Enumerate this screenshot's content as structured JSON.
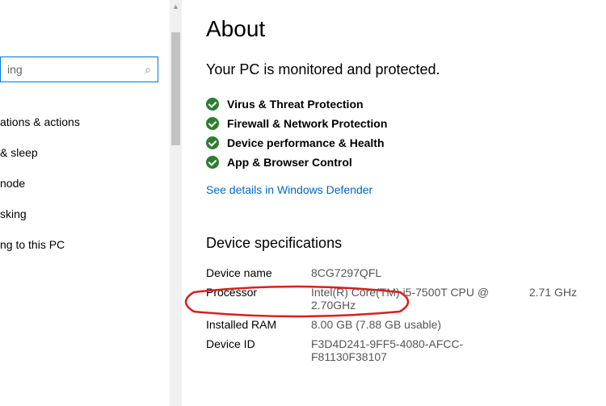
{
  "header": {
    "title": "About",
    "subtitle": "Your PC is monitored and protected."
  },
  "search": {
    "placeholder": "ing"
  },
  "sidebar": {
    "items": [
      {
        "label": "ations & actions"
      },
      {
        "label": "& sleep"
      },
      {
        "label": "node"
      },
      {
        "label": "sking"
      },
      {
        "label": "ng to this PC"
      }
    ]
  },
  "protection": {
    "items": [
      {
        "label": "Virus & Threat Protection"
      },
      {
        "label": "Firewall & Network Protection"
      },
      {
        "label": "Device performance & Health"
      },
      {
        "label": "App & Browser Control"
      }
    ],
    "link": "See details in Windows Defender"
  },
  "specs": {
    "heading": "Device specifications",
    "rows": [
      {
        "label": "Device name",
        "value": "8CG7297QFL",
        "extra": ""
      },
      {
        "label": "Processor",
        "value": "Intel(R) Core(TM) i5-7500T CPU @ 2.70GHz",
        "extra": "2.71 GHz"
      },
      {
        "label": "Installed RAM",
        "value": "8.00 GB (7.88 GB usable)",
        "extra": ""
      },
      {
        "label": "Device ID",
        "value": "F3D4D241-9FF5-4080-AFCC-F81130F38107",
        "extra": ""
      }
    ]
  }
}
